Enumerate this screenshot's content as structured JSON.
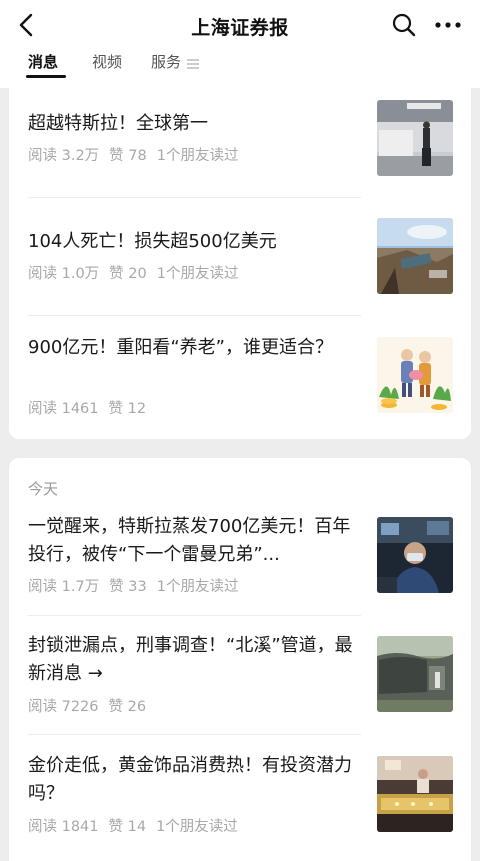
{
  "header": {
    "title": "上海证券报",
    "back_icon": "chevron-left-icon",
    "search_icon": "search-icon",
    "more_icon": "more-dots-icon"
  },
  "tabs": [
    {
      "label": "消息",
      "active": true
    },
    {
      "label": "视频",
      "active": false
    },
    {
      "label": "服务",
      "active": false,
      "icon": "menu-lines-icon"
    }
  ],
  "card1": {
    "articles": [
      {
        "title": "超越特斯拉！全球第一",
        "read": "阅读 3.2万",
        "likes": "赞 78",
        "friends": "1个朋友读过",
        "thumb": "car-showroom-photo"
      },
      {
        "title": "104人死亡！损失超500亿美元",
        "read": "阅读 1.0万",
        "likes": "赞 20",
        "friends": "1个朋友读过",
        "thumb": "flood-damage-photo"
      },
      {
        "title": "900亿元！重阳看“养老”，谁更适合？",
        "read": "阅读 1461",
        "likes": "赞 12",
        "friends": "",
        "thumb": "elderly-couple-illustration"
      }
    ]
  },
  "card2": {
    "section_label": "今天",
    "articles": [
      {
        "title": "一觉醒来，特斯拉蒸发700亿美元！百年投行，被传“下一个雷曼兄弟”...",
        "read": "阅读 1.7万",
        "likes": "赞 33",
        "friends": "1个朋友读过",
        "thumb": "trader-photo"
      },
      {
        "title": "封锁泄漏点，刑事调查！“北溪”管道，最新消息 →",
        "read": "阅读 7226",
        "likes": "赞 26",
        "friends": "",
        "thumb": "pipeline-photo"
      },
      {
        "title": "金价走低，黄金饰品消费热！有投资潜力吗？",
        "read": "阅读 1841",
        "likes": "赞 14",
        "friends": "1个朋友读过",
        "thumb": "jewelry-store-photo"
      }
    ]
  },
  "colors": {
    "background": "#ededed",
    "card": "#ffffff",
    "meta_text": "#a8a8a8"
  }
}
